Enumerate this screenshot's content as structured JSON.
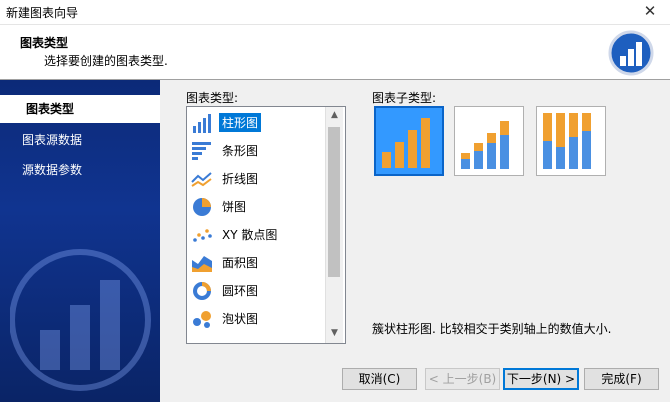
{
  "window": {
    "title": "新建图表向导",
    "close_label": "✕"
  },
  "header": {
    "title": "图表类型",
    "subtitle": "选择要创建的图表类型."
  },
  "sidebar": {
    "items": [
      {
        "label": "图表类型"
      },
      {
        "label": "图表源数据"
      },
      {
        "label": "源数据参数"
      }
    ]
  },
  "main": {
    "list_label": "图表类型:",
    "subtype_label": "图表子类型:",
    "chart_types": [
      {
        "label": "柱形图",
        "icon": "column-chart-icon"
      },
      {
        "label": "条形图",
        "icon": "bar-chart-icon"
      },
      {
        "label": "折线图",
        "icon": "line-chart-icon"
      },
      {
        "label": "饼图",
        "icon": "pie-chart-icon"
      },
      {
        "label": "XY 散点图",
        "icon": "scatter-chart-icon"
      },
      {
        "label": "面积图",
        "icon": "area-chart-icon"
      },
      {
        "label": "圆环图",
        "icon": "doughnut-chart-icon"
      },
      {
        "label": "泡状图",
        "icon": "bubble-chart-icon"
      }
    ],
    "selected_type": "柱形图",
    "subtypes": [
      "clustered-column",
      "stacked-column",
      "percent-stacked-column"
    ],
    "selected_subtype": "clustered-column",
    "description": "簇状柱形图. 比较相交于类别轴上的数值大小."
  },
  "buttons": {
    "cancel": "取消(C)",
    "back": "< 上一步(B)",
    "next": "下一步(N) >",
    "finish": "完成(F)"
  },
  "colors": {
    "accent": "#0078d7",
    "sidebar": "#103490",
    "bar_orange": "#f0a030",
    "bar_blue": "#4a90e2"
  }
}
